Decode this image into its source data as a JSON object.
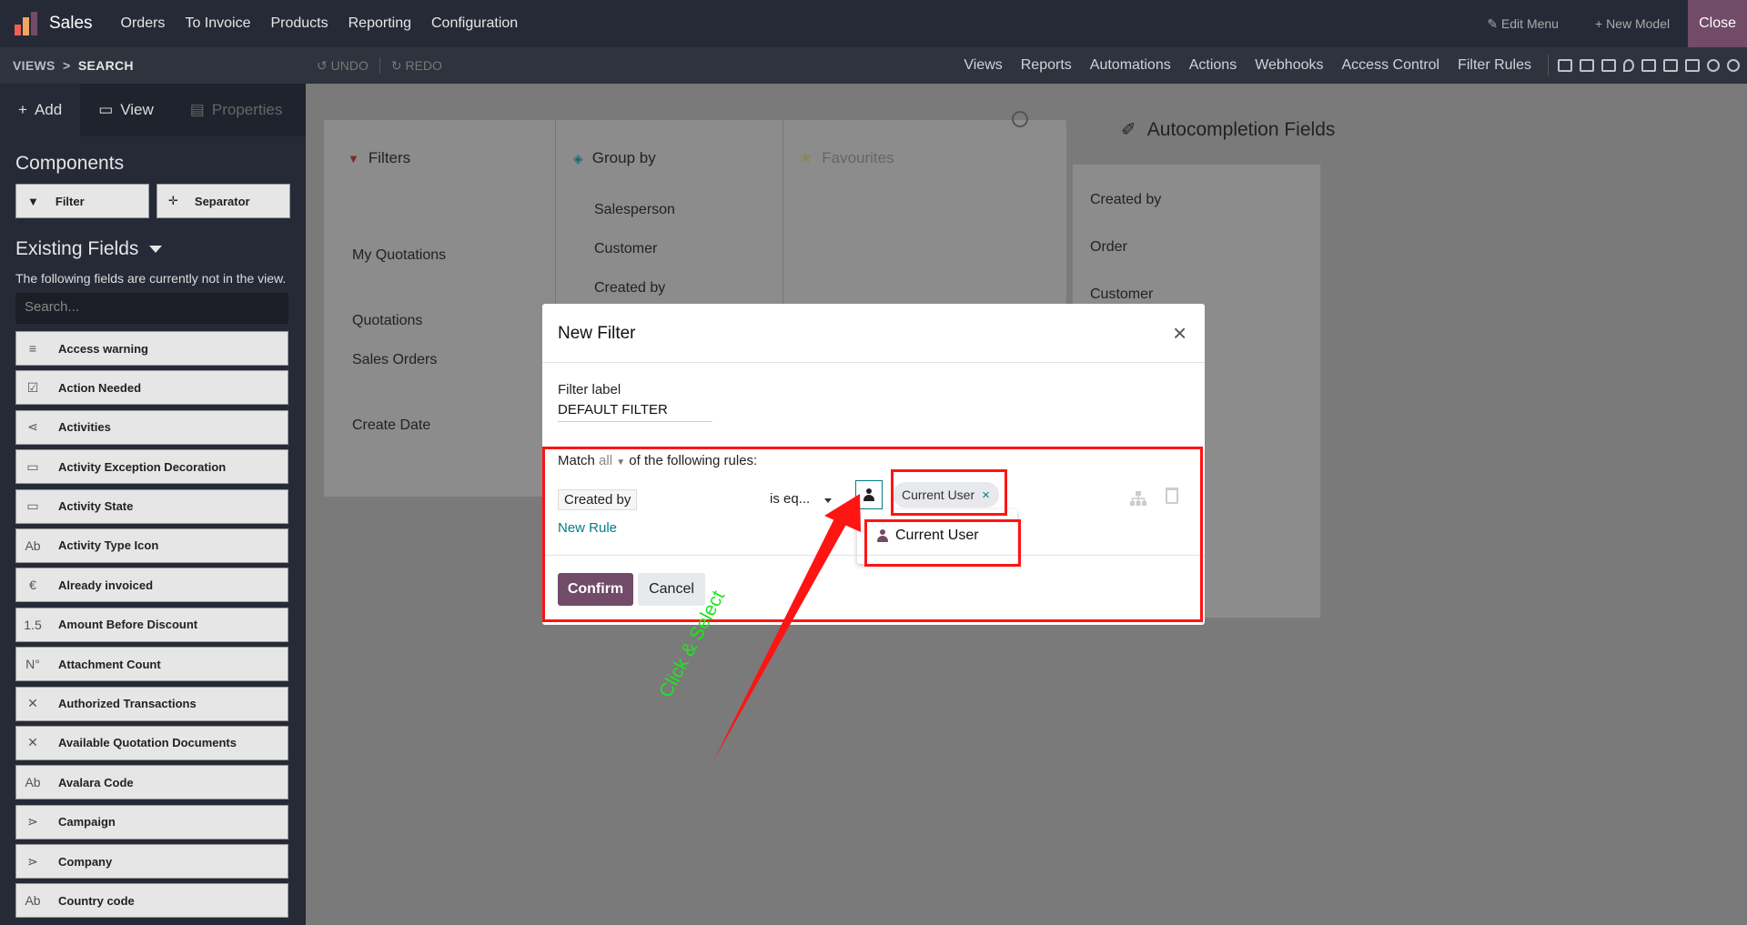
{
  "navbar": {
    "app_name": "Sales",
    "menu": [
      "Orders",
      "To Invoice",
      "Products",
      "Reporting",
      "Configuration"
    ],
    "edit_menu": "Edit Menu",
    "new_model": "New Model",
    "close": "Close"
  },
  "subbar": {
    "crumb_views": "VIEWS",
    "crumb_sep": ">",
    "crumb_search": "SEARCH",
    "undo": "UNDO",
    "redo": "REDO",
    "links": [
      "Views",
      "Reports",
      "Automations",
      "Actions",
      "Webhooks",
      "Access Control",
      "Filter Rules"
    ]
  },
  "sidebar": {
    "tabs": {
      "add": "Add",
      "view": "View",
      "properties": "Properties"
    },
    "components_title": "Components",
    "components": {
      "filter": "Filter",
      "separator": "Separator"
    },
    "existing_title": "Existing Fields",
    "note": "The following fields are currently not in the view.",
    "search_placeholder": "Search...",
    "fields": [
      {
        "icon": "≡",
        "label": "Access warning"
      },
      {
        "icon": "☑",
        "label": "Action Needed"
      },
      {
        "icon": "⋖",
        "label": "Activities"
      },
      {
        "icon": "▭",
        "label": "Activity Exception Decoration"
      },
      {
        "icon": "▭",
        "label": "Activity State"
      },
      {
        "icon": "Ab",
        "label": "Activity Type Icon"
      },
      {
        "icon": "€",
        "label": "Already invoiced"
      },
      {
        "icon": "1.5",
        "label": "Amount Before Discount"
      },
      {
        "icon": "N°",
        "label": "Attachment Count"
      },
      {
        "icon": "✕",
        "label": "Authorized Transactions"
      },
      {
        "icon": "✕",
        "label": "Available Quotation Documents"
      },
      {
        "icon": "Ab",
        "label": "Avalara Code"
      },
      {
        "icon": "⋗",
        "label": "Campaign"
      },
      {
        "icon": "⋗",
        "label": "Company"
      },
      {
        "icon": "Ab",
        "label": "Country code"
      }
    ]
  },
  "main": {
    "filters_head": "Filters",
    "filters": [
      "My Quotations",
      "Quotations",
      "Sales Orders",
      "Create Date"
    ],
    "groupby_head": "Group by",
    "groupby": [
      "Salesperson",
      "Customer",
      "Created by"
    ],
    "favourites_head": "Favourites",
    "autocomplete_title": "Autocompletion Fields",
    "autocomplete": [
      "Created by",
      "Order",
      "Customer"
    ]
  },
  "modal": {
    "title": "New Filter",
    "filter_label_caption": "Filter label",
    "filter_label_value": "DEFAULT FILTER",
    "match_prefix": "Match",
    "match_value": "all",
    "match_suffix": "of the following rules:",
    "rule_field": "Created by",
    "rule_operator": "is eq...",
    "tag_value": "Current User",
    "tag_remove": "×",
    "new_rule": "New Rule",
    "dropdown_option": "Current User",
    "confirm": "Confirm",
    "cancel": "Cancel"
  },
  "annotation": {
    "text": "Click & Select",
    "color": "#1ee61e",
    "box_color": "#ff1414"
  }
}
